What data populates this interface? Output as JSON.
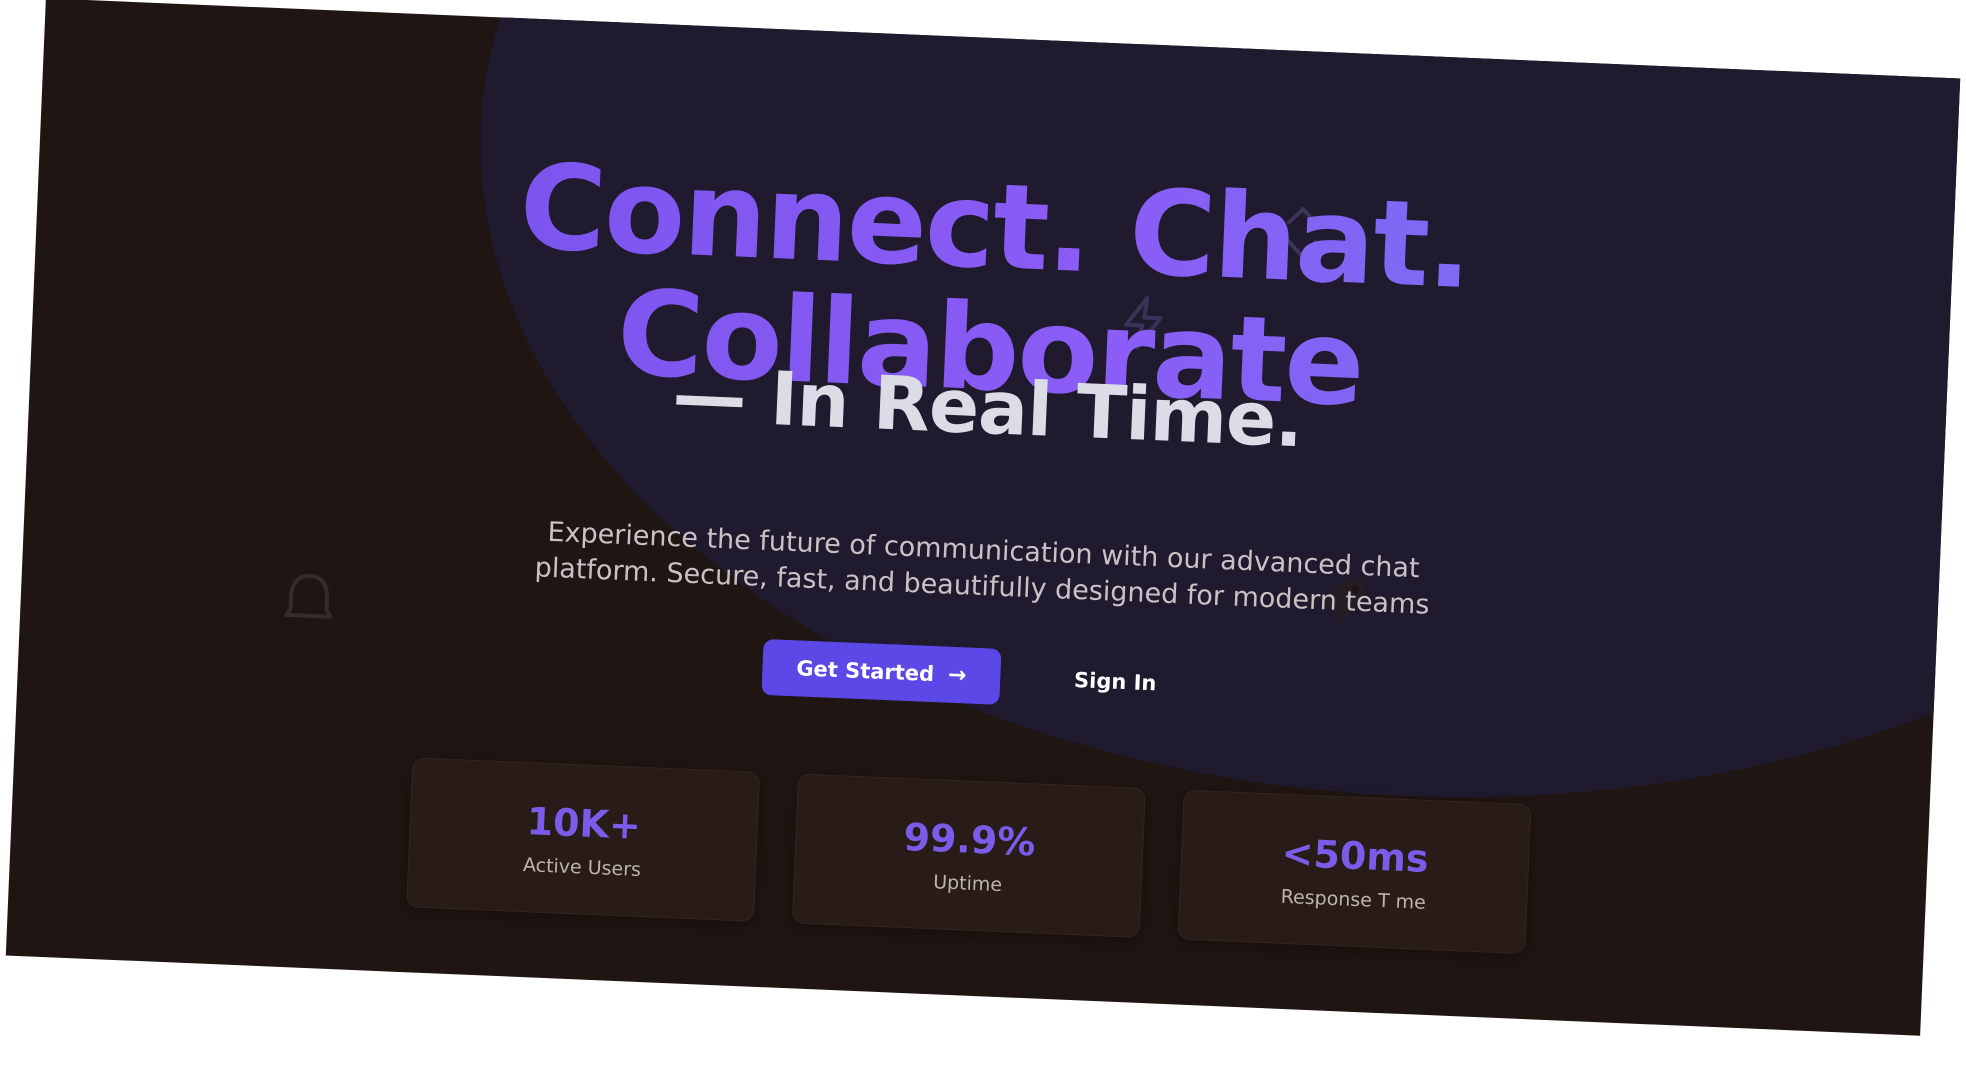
{
  "hero": {
    "headline_line1": "Connect. Chat.",
    "headline_line2": "Collaborate",
    "subheadline": "— In Real Time.",
    "description": "Experience the future of communication with our advanced chat platform. Secure, fast, and beautifully designed for modern teams",
    "primary_cta": {
      "label": "Get Started",
      "icon": "arrow-right-icon"
    },
    "secondary_cta": {
      "label": "Sign In"
    }
  },
  "stats": [
    {
      "value": "10K+",
      "label": "Active Users"
    },
    {
      "value": "99.9%",
      "label": "Uptime"
    },
    {
      "value": "<50ms",
      "label": "Response T me"
    }
  ],
  "decorations": [
    "chevron-up-down-icon",
    "lightning-icon",
    "bell-icon",
    "tag-icon"
  ],
  "colors": {
    "background": "#1f1512",
    "blob": "#1f1a2e",
    "accent": "#5b48e6",
    "headline_gradient": [
      "#6f4fe6",
      "#8b5cf6",
      "#6a7bf0"
    ],
    "stat_value": "#7a5ce8",
    "card": "#281b18"
  }
}
